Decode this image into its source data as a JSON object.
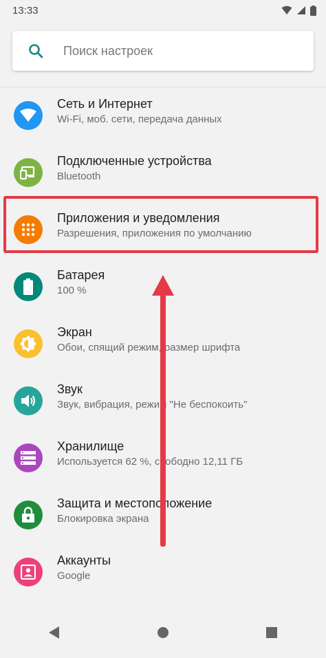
{
  "status": {
    "time": "13:33",
    "icons": [
      "wifi-icon",
      "signal-icon",
      "battery-icon"
    ]
  },
  "search": {
    "placeholder": "Поиск настроек",
    "icon": "search-icon"
  },
  "items": [
    {
      "title": "Сеть и Интернет",
      "subtitle": "Wi-Fi, моб. сети, передача данных",
      "icon": "wifi-icon",
      "color": "#2196f3"
    },
    {
      "title": "Подключенные устройства",
      "subtitle": "Bluetooth",
      "icon": "devices-icon",
      "color": "#7cb342"
    },
    {
      "title": "Приложения и уведомления",
      "subtitle": "Разрешения, приложения по умолчанию",
      "icon": "apps-icon",
      "color": "#f57c00"
    },
    {
      "title": "Батарея",
      "subtitle": "100 %",
      "icon": "battery-icon",
      "color": "#00897b"
    },
    {
      "title": "Экран",
      "subtitle": "Обои, спящий режим, размер шрифта",
      "icon": "brightness-icon",
      "color": "#fbc02d"
    },
    {
      "title": "Звук",
      "subtitle": "Звук, вибрация, режим \"Не беспокоить\"",
      "icon": "volume-icon",
      "color": "#26a69a"
    },
    {
      "title": "Хранилище",
      "subtitle": "Используется 62 %, свободно 12,11 ГБ",
      "icon": "storage-icon",
      "color": "#ab47bc"
    },
    {
      "title": "Защита и местоположение",
      "subtitle": "Блокировка экрана",
      "icon": "lock-icon",
      "color": "#1e8e3e"
    },
    {
      "title": "Аккаунты",
      "subtitle": "Google",
      "icon": "account-icon",
      "color": "#ec407a"
    }
  ],
  "annotation": {
    "highlight_color": "#e53946",
    "highlighted_item": "Приложения и уведомления"
  },
  "navbar": [
    "back-icon",
    "home-icon",
    "recents-icon"
  ]
}
